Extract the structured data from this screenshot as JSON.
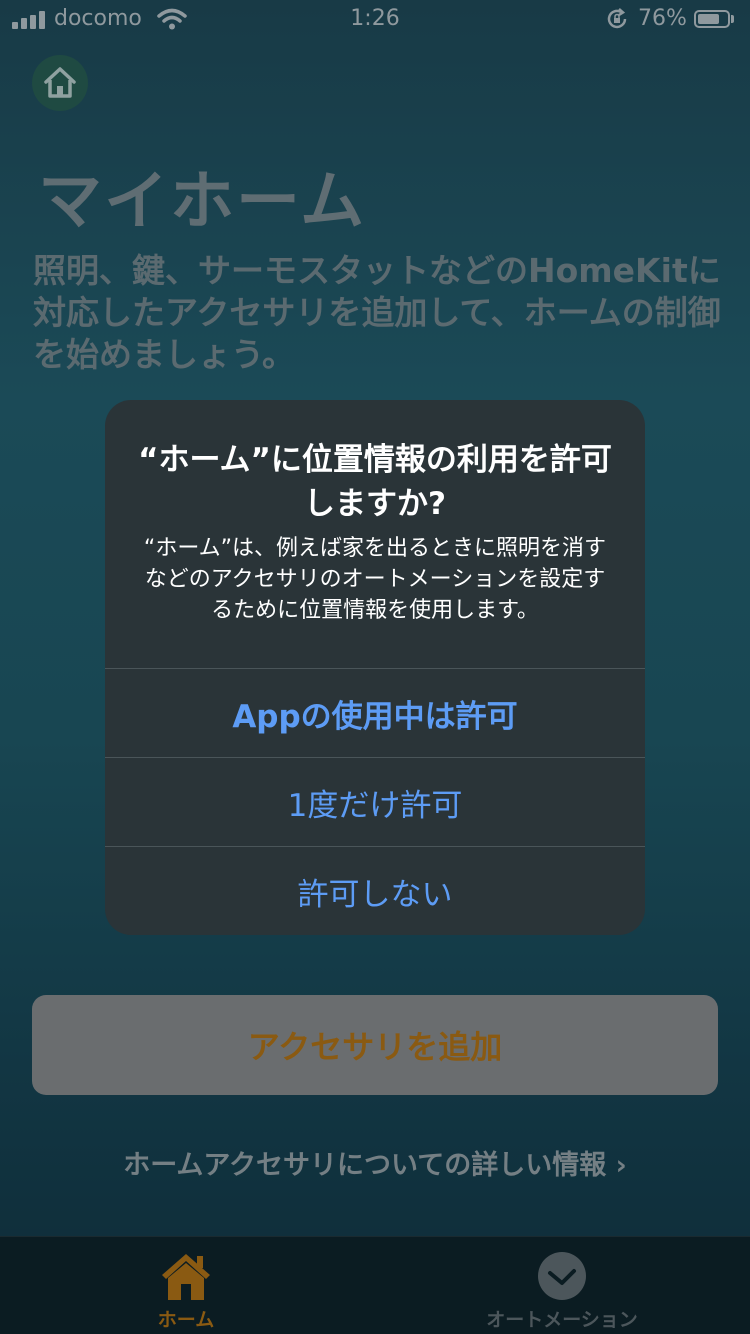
{
  "status_bar": {
    "carrier": "docomo",
    "time": "1:26",
    "battery_percent": "76%",
    "battery_level": 0.76
  },
  "background_page": {
    "title": "マイホーム",
    "description": "照明、鍵、サーモスタットなどのHomeKitに対応したアクセサリを追加して、ホームの制御を始めましょう。",
    "add_button_label": "アクセサリを追加",
    "more_info_link": "ホームアクセサリについての詳しい情報 ›"
  },
  "alert": {
    "title": "“ホーム”に位置情報の利用を許可しますか?",
    "message": "“ホーム”は、例えば家を出るときに照明を消すなどのアクセサリのオートメーションを設定するために位置情報を使用します。",
    "buttons": [
      {
        "label": "Appの使用中は許可"
      },
      {
        "label": "1度だけ許可"
      },
      {
        "label": "許可しない"
      }
    ]
  },
  "tab_bar": {
    "tabs": [
      {
        "label": "ホーム",
        "icon": "house-icon",
        "selected": true
      },
      {
        "label": "オートメーション",
        "icon": "clock-check-icon",
        "selected": false
      }
    ]
  },
  "colors": {
    "accent_orange": "#8a5a12",
    "alert_button_blue": "#5d9cf5",
    "alert_background": "#2a3438"
  }
}
